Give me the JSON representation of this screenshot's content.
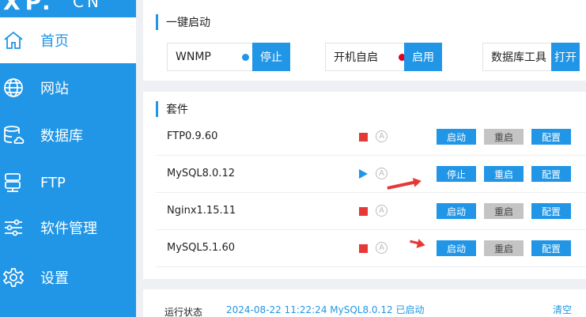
{
  "logo": {
    "main": "XP.",
    "suffix": "CN"
  },
  "sidebar": {
    "items": [
      {
        "label": "首页",
        "icon": "home-icon"
      },
      {
        "label": "网站",
        "icon": "globe-icon"
      },
      {
        "label": "数据库",
        "icon": "database-icon"
      },
      {
        "label": "FTP",
        "icon": "ftp-server-icon"
      },
      {
        "label": "软件管理",
        "icon": "sliders-icon"
      },
      {
        "label": "设置",
        "icon": "gear-icon"
      }
    ]
  },
  "quickstart": {
    "title": "一键启动",
    "boxes": [
      {
        "label": "WNMP",
        "status_color": "#2196e6",
        "button": "停止"
      },
      {
        "label": "开机自启",
        "status_color": "#e0001b",
        "button": "启用"
      },
      {
        "label": "数据库工具",
        "button": "打开"
      }
    ]
  },
  "suite": {
    "title": "套件",
    "rows": [
      {
        "name": "FTP0.9.60",
        "state": "stopped",
        "action": "启动",
        "restart": "重启",
        "config": "配置"
      },
      {
        "name": "MySQL8.0.12",
        "state": "running",
        "action": "停止",
        "restart": "重启",
        "config": "配置"
      },
      {
        "name": "Nginx1.15.11",
        "state": "stopped",
        "action": "启动",
        "restart": "重启",
        "config": "配置"
      },
      {
        "name": "MySQL5.1.60",
        "state": "stopped",
        "action": "启动",
        "restart": "重启",
        "config": "配置"
      }
    ],
    "auto_badge": "A"
  },
  "log": {
    "label": "运行状态",
    "message": "2024-08-22 11:22:24 MySQL8.0.12 已启动",
    "clear": "清空"
  },
  "colors": {
    "accent": "#2196e6",
    "stopped": "#e53935",
    "annotation_arrow": "#e53935"
  }
}
